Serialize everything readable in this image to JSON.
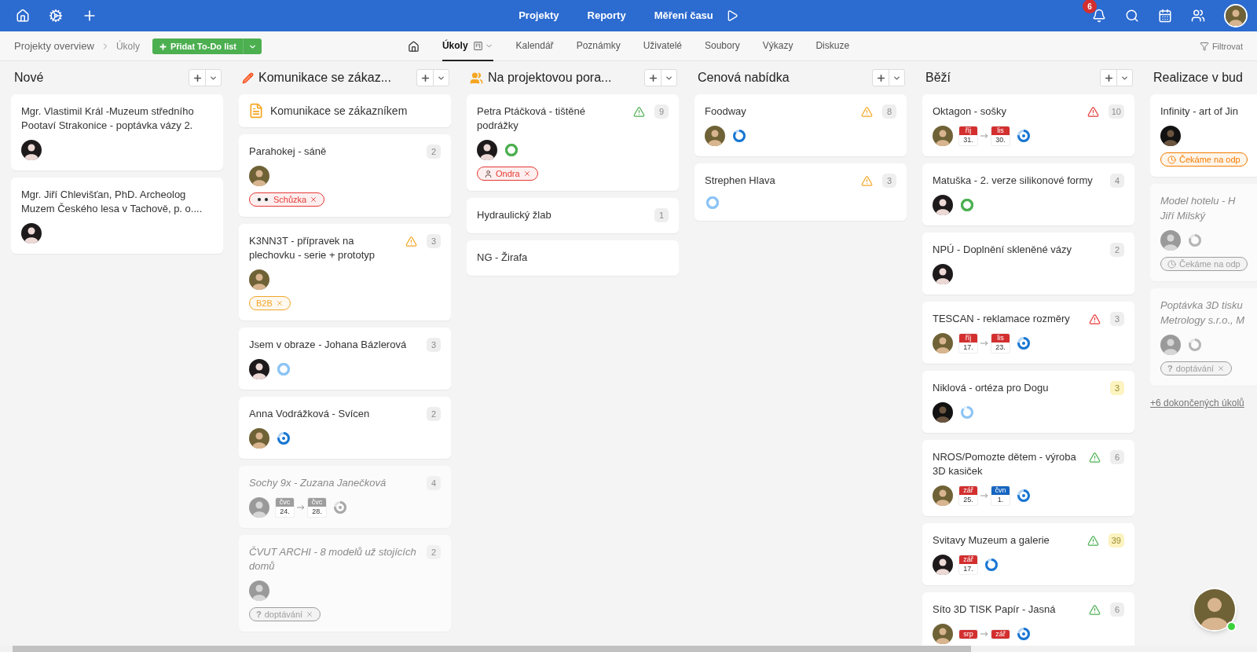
{
  "top_nav": {
    "items": [
      "Projekty",
      "Reporty",
      "Měření času"
    ],
    "notifications_badge": "6"
  },
  "toolbar": {
    "breadcrumb": [
      "Projekty overview",
      "Úkoly"
    ],
    "add_button": "Přidat To-Do list",
    "filter_label": "Filtrovat",
    "tabs": [
      {
        "label": "Úkoly",
        "selected": true,
        "view_switch": true
      },
      {
        "label": "Kalendář",
        "selected": false,
        "view_switch": false
      },
      {
        "label": "Poznámky",
        "selected": false,
        "view_switch": false
      },
      {
        "label": "Uživatelé",
        "selected": false,
        "view_switch": false
      },
      {
        "label": "Soubory",
        "selected": false,
        "view_switch": false
      },
      {
        "label": "Výkazy",
        "selected": false,
        "view_switch": false
      },
      {
        "label": "Diskuze",
        "selected": false,
        "view_switch": false
      }
    ]
  },
  "columns": [
    {
      "title": "Nové",
      "kind": "plain",
      "cards": [
        {
          "kind": "task",
          "title": "Mgr. Vlastimil Král -Muzeum středního Pootaví Strakonice - poptávka vázy 2.",
          "done": false,
          "avatar": {
            "kind": "woman"
          }
        },
        {
          "kind": "task",
          "title": "Mgr. Jiří Chlevišťan, PhD. Archeolog Muzem Českého lesa v Tachově, p. o....",
          "done": false,
          "avatar": {
            "kind": "woman"
          }
        }
      ]
    },
    {
      "title": "Komunikace se zákaz...",
      "kind": "edit",
      "cards": [
        {
          "kind": "note",
          "title": "Komunikace se zákazníkem"
        },
        {
          "kind": "task",
          "title": "Parahokej - sáně",
          "done": false,
          "count": {
            "text": "2",
            "highlight": false
          },
          "avatar": {
            "kind": "man"
          },
          "tags": [
            {
              "label": "Schůzka",
              "kind": "meeting",
              "color": "#e53935",
              "removable": true
            }
          ]
        },
        {
          "kind": "task",
          "title": "K3NN3T - přípravek na plechovku - serie + prototyp",
          "done": false,
          "alert": {
            "kind": "warning"
          },
          "count": {
            "text": "3",
            "highlight": false
          },
          "avatar": {
            "kind": "man"
          },
          "tags": [
            {
              "label": "B2B",
              "kind": "label",
              "color": "#f0a52a",
              "removable": true
            }
          ]
        },
        {
          "kind": "task",
          "title": "Jsem v obraze - Johana Bázlerová",
          "done": false,
          "count": {
            "text": "3",
            "highlight": false
          },
          "avatar": {
            "kind": "woman"
          },
          "ring": {
            "kind": "open"
          }
        },
        {
          "kind": "task",
          "title": "Anna Vodrážková - Svícen",
          "done": false,
          "count": {
            "text": "2",
            "highlight": false
          },
          "avatar": {
            "kind": "man"
          },
          "ring": {
            "kind": "target"
          }
        },
        {
          "kind": "task",
          "title": "Sochy 9x - Zuzana Janečková",
          "done": true,
          "count": {
            "text": "4",
            "highlight": false
          },
          "avatar": {
            "kind": "man"
          },
          "dates": [
            {
              "month": "čvc",
              "day": "24.",
              "kind": "muted"
            },
            {
              "month": "čvc",
              "day": "28.",
              "kind": "muted"
            }
          ],
          "ring": {
            "kind": "muted-target"
          }
        },
        {
          "kind": "task",
          "title": "ČVUT ARCHI - 8 modelů už stojících domů",
          "done": true,
          "count": {
            "text": "2",
            "highlight": false
          },
          "avatar": {
            "kind": "woman"
          },
          "tags": [
            {
              "label": "doptávání",
              "symbol": "?",
              "kind": "inquiry",
              "color": "#9e9e9e",
              "removable": true
            }
          ]
        }
      ]
    },
    {
      "title": "Na projektovou pora...",
      "kind": "team",
      "cards": [
        {
          "kind": "task",
          "title": "Petra Ptáčková - tištěné podrážky",
          "done": false,
          "alert": {
            "kind": "ok"
          },
          "count": {
            "text": "9",
            "highlight": false
          },
          "avatar": {
            "kind": "woman"
          },
          "ring": {
            "kind": "approved"
          },
          "tags": [
            {
              "label": "Ondra",
              "kind": "person",
              "color": "#e53935",
              "removable": true
            }
          ]
        },
        {
          "kind": "task",
          "title": "Hydraulický žlab",
          "done": false,
          "count": {
            "text": "1",
            "highlight": false
          }
        },
        {
          "kind": "task",
          "title": "NG - Žirafa",
          "done": false
        }
      ]
    },
    {
      "title": "Cenová nabídka",
      "kind": "plain",
      "cards": [
        {
          "kind": "task",
          "title": "Foodway",
          "done": false,
          "alert": {
            "kind": "warning"
          },
          "count": {
            "text": "8",
            "highlight": false
          },
          "avatar": {
            "kind": "man"
          },
          "ring": {
            "kind": "partial"
          }
        },
        {
          "kind": "task",
          "title": "Strephen Hlava",
          "done": false,
          "alert": {
            "kind": "warning"
          },
          "count": {
            "text": "3",
            "highlight": false
          },
          "ring": {
            "kind": "open"
          }
        }
      ]
    },
    {
      "title": "Běží",
      "kind": "plain",
      "cards": [
        {
          "kind": "task",
          "title": "Oktagon - sošky",
          "done": false,
          "alert": {
            "kind": "danger"
          },
          "count": {
            "text": "10",
            "highlight": false
          },
          "avatar": {
            "kind": "man"
          },
          "dates": [
            {
              "month": "říj",
              "day": "31.",
              "kind": "late"
            },
            {
              "month": "lis",
              "day": "30.",
              "kind": "late"
            }
          ],
          "ring": {
            "kind": "target"
          }
        },
        {
          "kind": "task",
          "title": "Matuška - 2. verze silikonové formy",
          "done": false,
          "count": {
            "text": "4",
            "highlight": false
          },
          "avatar": {
            "kind": "woman"
          },
          "ring": {
            "kind": "approved"
          }
        },
        {
          "kind": "task",
          "title": "NPÚ - Doplnění skleněné vázy",
          "done": false,
          "count": {
            "text": "2",
            "highlight": false
          },
          "avatar": {
            "kind": "woman"
          }
        },
        {
          "kind": "task",
          "title": "TESCAN - reklamace rozměry",
          "done": false,
          "alert": {
            "kind": "danger"
          },
          "count": {
            "text": "3",
            "highlight": false
          },
          "avatar": {
            "kind": "man"
          },
          "dates": [
            {
              "month": "říj",
              "day": "17.",
              "kind": "late"
            },
            {
              "month": "lis",
              "day": "23.",
              "kind": "late"
            }
          ],
          "ring": {
            "kind": "target"
          }
        },
        {
          "kind": "task",
          "title": "Niklová - ortéza pro Dogu",
          "done": false,
          "count": {
            "text": "3",
            "highlight": true
          },
          "avatar": {
            "kind": "dark"
          },
          "ring": {
            "kind": "open-partial"
          }
        },
        {
          "kind": "task",
          "title": "NROS/Pomozte dětem - výroba 3D kasiček",
          "done": false,
          "alert": {
            "kind": "ok"
          },
          "count": {
            "text": "6",
            "highlight": false
          },
          "avatar": {
            "kind": "man"
          },
          "dates": [
            {
              "month": "zář",
              "day": "25.",
              "kind": "late"
            },
            {
              "month": "čvn",
              "day": "1.",
              "kind": "planned"
            }
          ],
          "ring": {
            "kind": "target"
          }
        },
        {
          "kind": "task",
          "title": "Svitavy Muzeum a galerie",
          "done": false,
          "alert": {
            "kind": "ok"
          },
          "count": {
            "text": "39",
            "highlight": true
          },
          "avatar": {
            "kind": "woman"
          },
          "dates": [
            {
              "month": "zář",
              "day": "17.",
              "kind": "late"
            }
          ],
          "ring": {
            "kind": "partial"
          }
        },
        {
          "kind": "task",
          "title": "Síto 3D TISK Papír - Jasná",
          "done": false,
          "alert": {
            "kind": "ok"
          },
          "count": {
            "text": "6",
            "highlight": false
          },
          "avatar": {
            "kind": "man"
          },
          "dates": [
            {
              "month": "srp",
              "kind": "late"
            },
            {
              "month": "zář",
              "kind": "late"
            }
          ],
          "ring": {
            "kind": "target"
          }
        }
      ]
    },
    {
      "title": "Realizace v bud",
      "kind": "plain",
      "cards": [
        {
          "kind": "task",
          "title": [
            "Infinity - art of Jin"
          ],
          "done": false,
          "avatar": {
            "kind": "dark"
          },
          "tags": [
            {
              "label": "Čekáme na odp",
              "kind": "waiting",
              "color": "#f57c00",
              "removable": false
            }
          ]
        },
        {
          "kind": "task",
          "title": [
            "Model hotelu - H",
            "Jiří Milský"
          ],
          "done": true,
          "avatar": {
            "kind": "woman"
          },
          "ring": {
            "kind": "muted-partial"
          },
          "tags": [
            {
              "label": "Čekáme na odp",
              "kind": "waiting",
              "color": "#9e9e9e",
              "removable": false
            }
          ]
        },
        {
          "kind": "task",
          "title": [
            "Poptávka 3D tisku",
            "Metrology s.r.o., M"
          ],
          "done": true,
          "avatar": {
            "kind": "man"
          },
          "ring": {
            "kind": "muted-partial"
          },
          "tags": [
            {
              "label": "doptávání",
              "symbol": "?",
              "kind": "inquiry",
              "color": "#9e9e9e",
              "removable": true
            }
          ]
        },
        {
          "kind": "link",
          "title": "+6 dokončených úkolů"
        }
      ]
    }
  ],
  "chat": {
    "online": true
  }
}
